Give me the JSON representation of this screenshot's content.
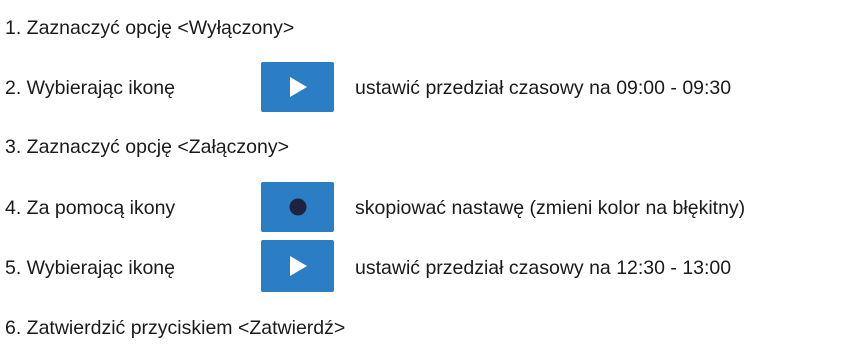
{
  "accent_color": "#2b7ec3",
  "icons": {
    "play": "play-triangle-icon",
    "record": "dot-icon"
  },
  "steps": [
    {
      "text": "1. Zaznaczyć opcję <Wyłączony>"
    },
    {
      "text": "2. Wybierając ikonę",
      "tail": "ustawić przedział czasowy na 09:00 - 09:30"
    },
    {
      "text": "3. Zaznaczyć opcję <Załączony>"
    },
    {
      "text": "4. Za pomocą ikony",
      "tail": "skopiować nastawę (zmieni kolor na błękitny)"
    },
    {
      "text": "5.  Wybierając ikonę",
      "tail": "ustawić przedział czasowy na 12:30 - 13:00"
    },
    {
      "text": "6. Zatwierdzić przyciskiem <Zatwierdź>"
    }
  ]
}
